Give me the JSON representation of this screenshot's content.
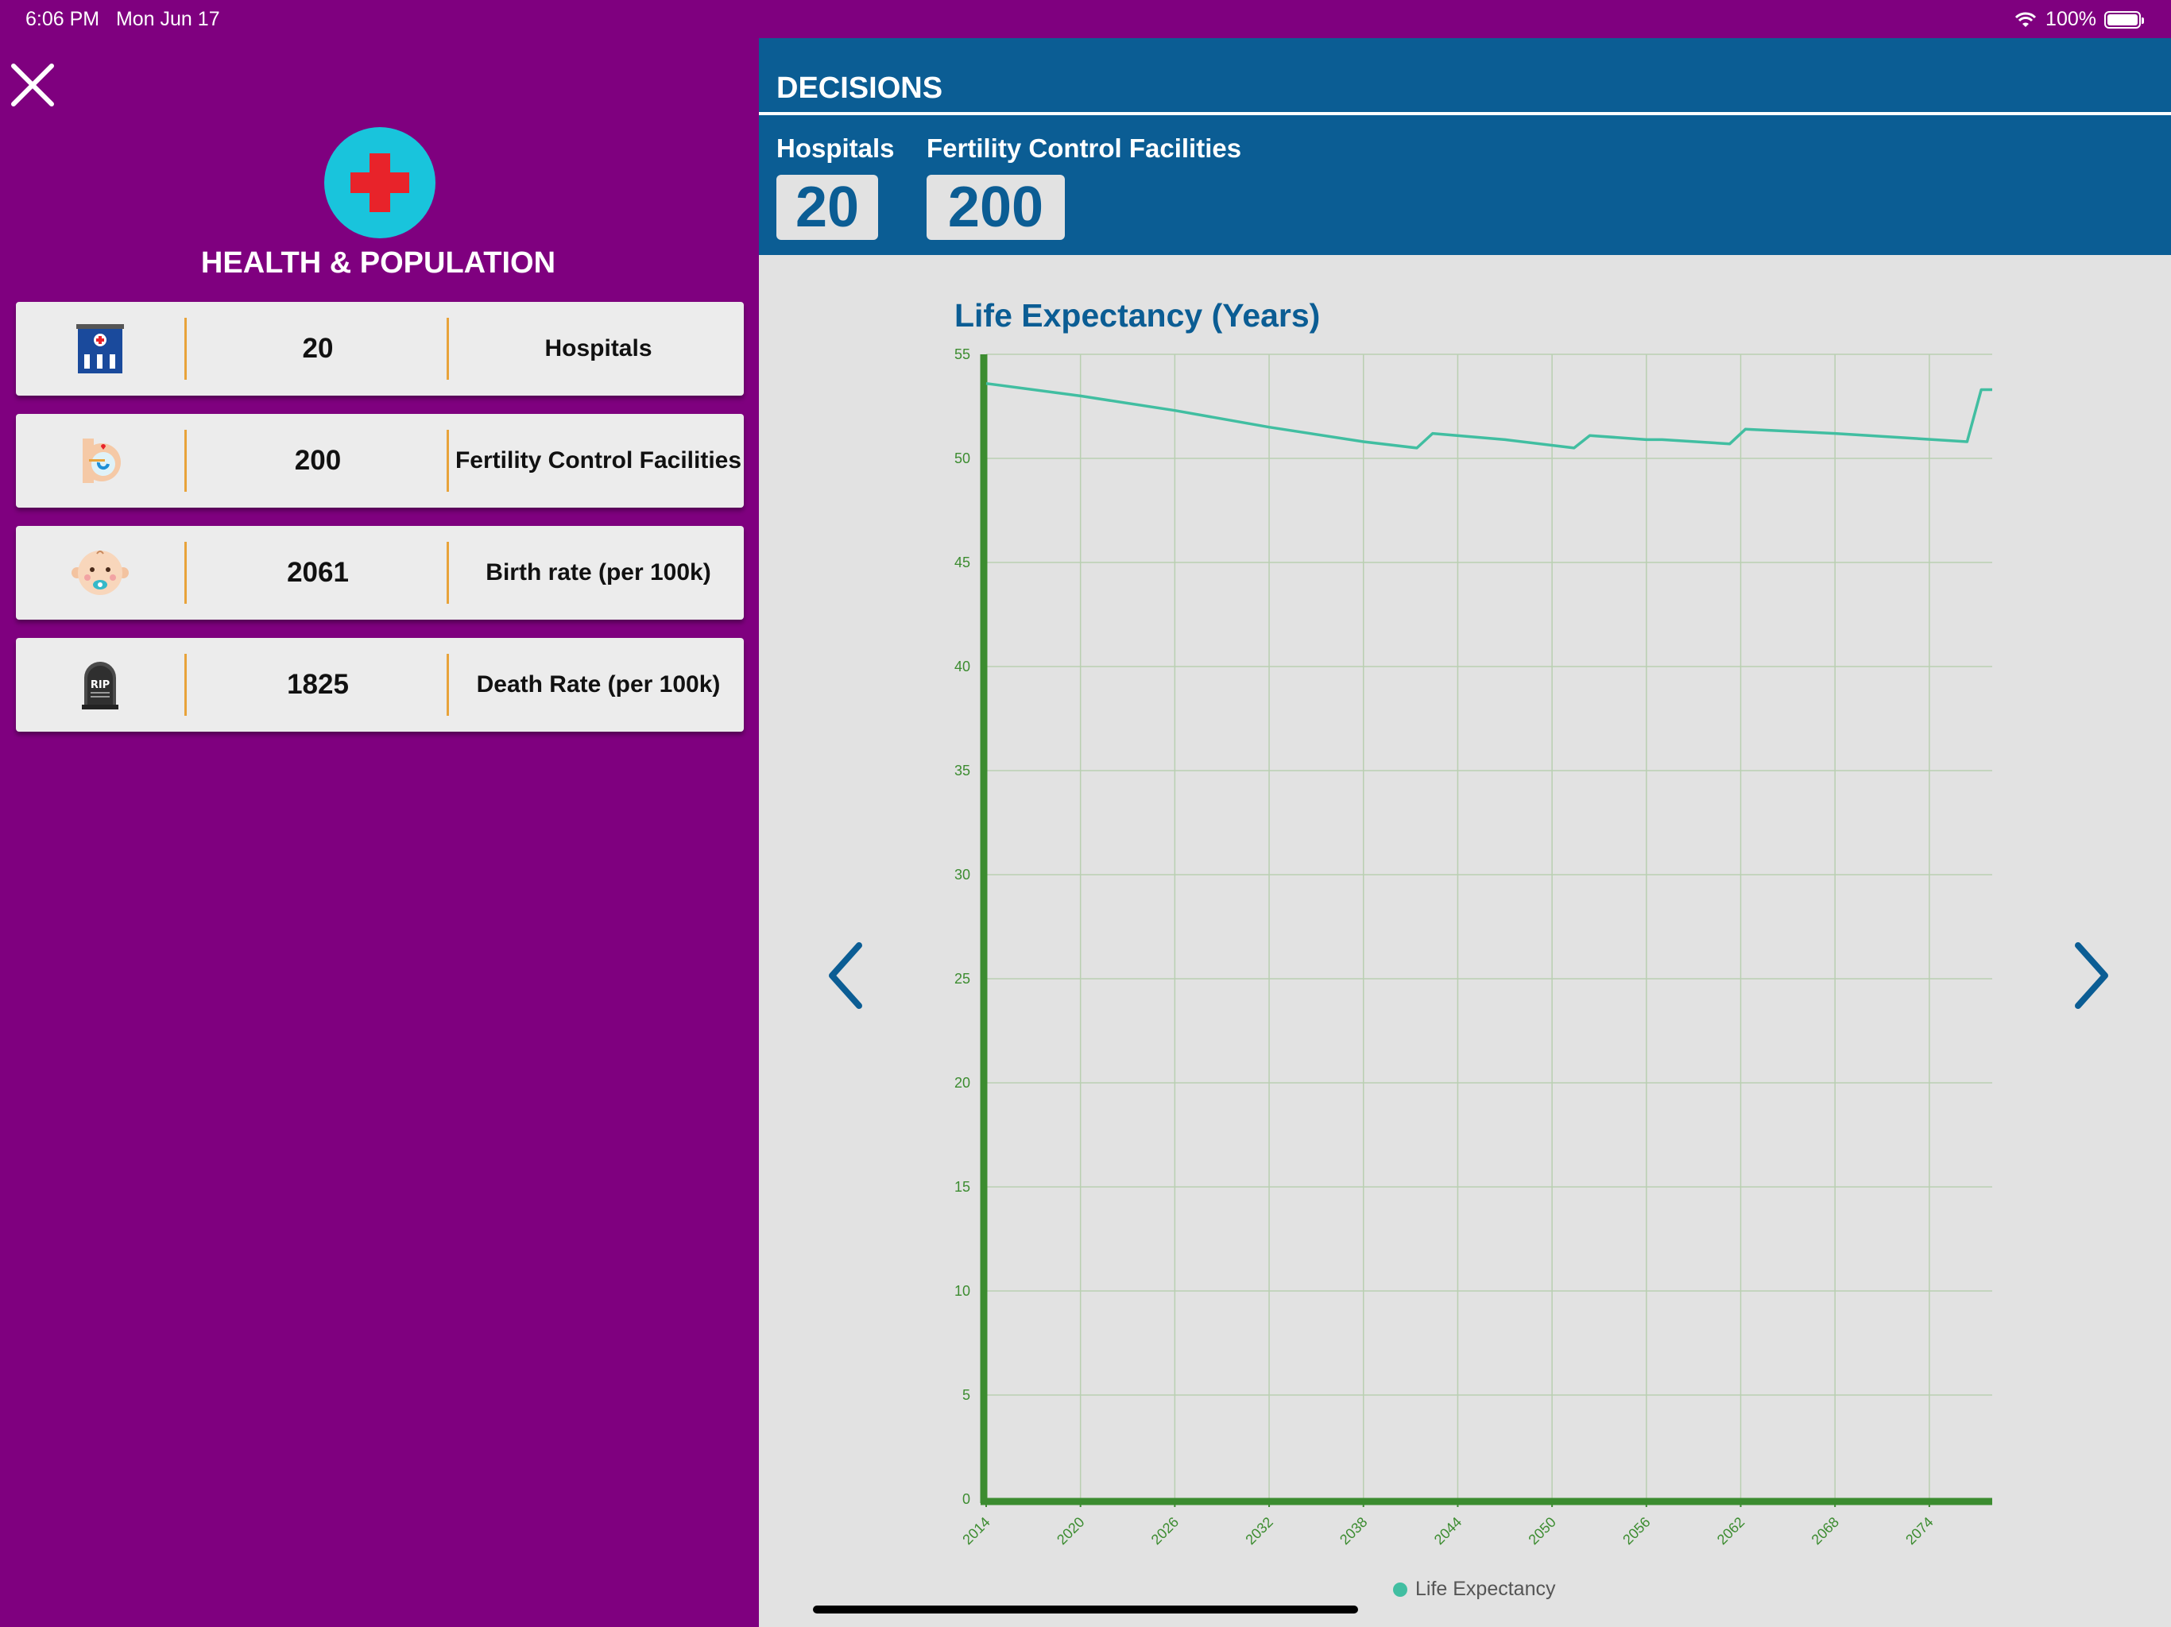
{
  "status": {
    "time": "6:06 PM",
    "date": "Mon Jun 17",
    "battery": "100%"
  },
  "icons": {
    "close": "close-icon",
    "health": "medical-cross-icon",
    "hospital": "hospital-building-icon",
    "fertility": "pregnant-belly-icon",
    "birth": "baby-face-icon",
    "death": "rip-tombstone-icon",
    "prev": "chevron-left-icon",
    "next": "chevron-right-icon",
    "wifi": "wifi-icon",
    "battery": "battery-icon"
  },
  "sidebar": {
    "title": "HEALTH & POPULATION",
    "cards": [
      {
        "value": "20",
        "label": "Hospitals"
      },
      {
        "value": "200",
        "label": "Fertility Control Facilities"
      },
      {
        "value": "2061",
        "label": "Birth rate (per 100k)"
      },
      {
        "value": "1825",
        "label": "Death Rate (per 100k)"
      }
    ]
  },
  "decisions": {
    "title": "DECISIONS",
    "items": [
      {
        "label": "Hospitals",
        "value": "20"
      },
      {
        "label": "Fertility Control Facilities",
        "value": "200"
      }
    ]
  },
  "colors": {
    "background": "#7f007f",
    "header": "#0b5d94",
    "accent": "#19c4dc",
    "series": "#41bea1",
    "axis": "#3c8c30"
  },
  "chart_data": {
    "type": "line",
    "title": "Life Expectancy (Years)",
    "xlabel": "",
    "ylabel": "",
    "ylim": [
      0,
      55
    ],
    "xlim": [
      2014,
      2078
    ],
    "yticks": [
      0,
      5,
      10,
      15,
      20,
      25,
      30,
      35,
      40,
      45,
      50,
      55
    ],
    "xticks": [
      2014,
      2020,
      2026,
      2032,
      2038,
      2044,
      2050,
      2056,
      2062,
      2068,
      2074
    ],
    "grid": true,
    "legend_position": "bottom",
    "series": [
      {
        "name": "Life Expectancy",
        "x": [
          2014,
          2020,
          2026,
          2032,
          2038,
          2041.4,
          2042.4,
          2047,
          2051.4,
          2052.4,
          2056,
          2057,
          2061.3,
          2062.3,
          2068,
          2076.4,
          2077.3,
          2078
        ],
        "y": [
          53.6,
          53.0,
          52.3,
          51.5,
          50.8,
          50.5,
          51.2,
          50.9,
          50.5,
          51.1,
          50.9,
          50.9,
          50.7,
          51.4,
          51.2,
          50.8,
          53.3,
          53.3
        ]
      }
    ]
  }
}
